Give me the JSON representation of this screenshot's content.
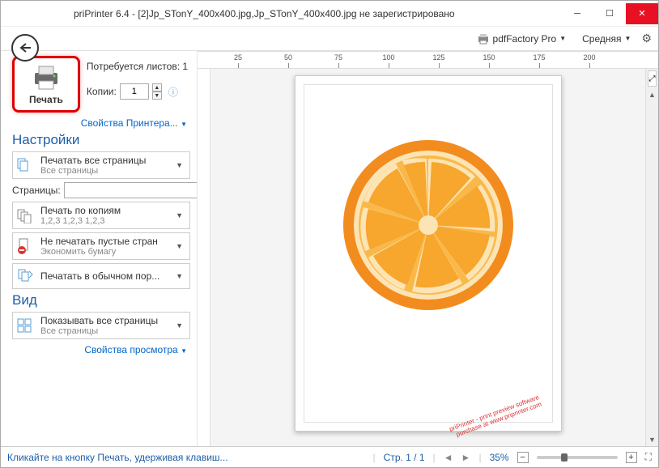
{
  "title": "priPrinter 6.4 - [2]Jp_STonY_400x400.jpg,Jp_STonY_400x400.jpg не зарегистрировано",
  "toolbar": {
    "printer": "pdfFactory Pro",
    "quality": "Средняя"
  },
  "print": {
    "button_label": "Печать",
    "sheets_label": "Потребуется листов:",
    "sheets_value": "1",
    "copies_label": "Копии:",
    "copies_value": "1",
    "printer_props": "Свойства Принтера..."
  },
  "settings": {
    "title": "Настройки",
    "all_pages": {
      "t1": "Печатать все страницы",
      "t2": "Все страницы"
    },
    "pages_label": "Страницы:",
    "collate": {
      "t1": "Печать по копиям",
      "t2": "1,2,3  1,2,3  1,2,3"
    },
    "skip_empty": {
      "t1": "Не печатать пустые стран",
      "t2": "Экономить бумагу"
    },
    "normal_order": {
      "t1": "Печатать в обычном пор..."
    }
  },
  "view": {
    "title": "Вид",
    "show_all": {
      "t1": "Показывать все страницы",
      "t2": "Все страницы"
    },
    "view_props": "Свойства просмотра"
  },
  "ruler": [
    "25",
    "50",
    "75",
    "100",
    "125",
    "150",
    "175",
    "200"
  ],
  "watermark": {
    "line1": "priPrinter - print preview software",
    "line2": "purchase at www.priprinter.com"
  },
  "status": {
    "hint": "Кликайте на кнопку Печать, удерживая клавиш...",
    "page": "Стр. 1 / 1",
    "zoom": "35%"
  }
}
